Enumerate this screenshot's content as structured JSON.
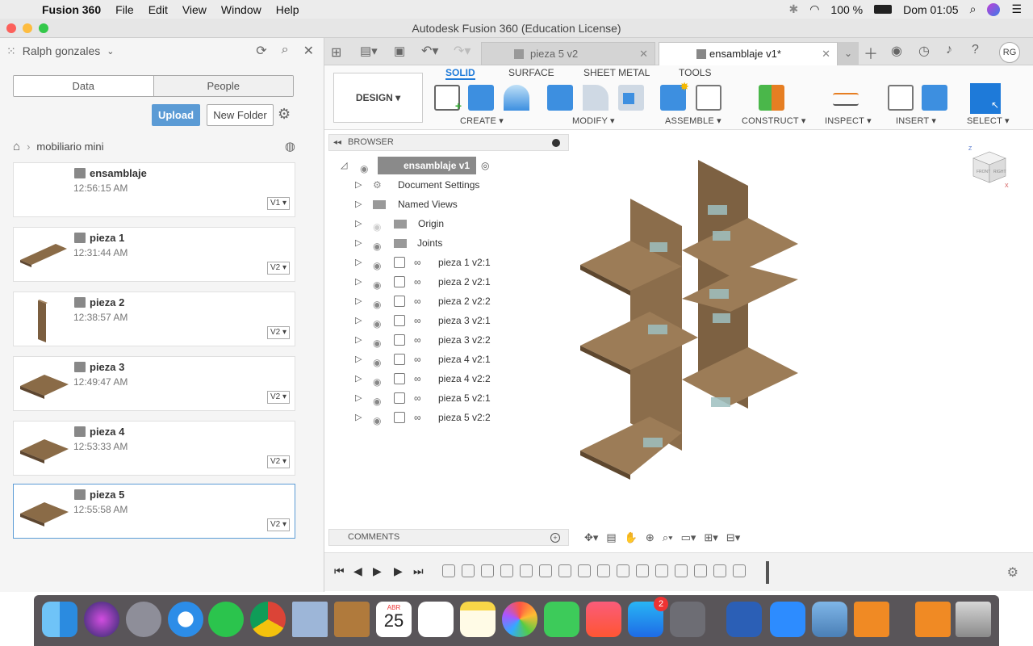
{
  "menubar": {
    "app": "Fusion 360",
    "items": [
      "File",
      "Edit",
      "View",
      "Window",
      "Help"
    ],
    "battery": "100 %",
    "clock": "Dom 01:05"
  },
  "window": {
    "title": "Autodesk Fusion 360 (Education License)"
  },
  "leftpanel": {
    "user": "Ralph gonzales",
    "tabs": {
      "data": "Data",
      "people": "People"
    },
    "upload": "Upload",
    "new_folder": "New Folder",
    "breadcrumb": "mobiliario mini",
    "files": [
      {
        "name": "ensamblaje",
        "time": "12:56:15 AM",
        "version": "V1"
      },
      {
        "name": "pieza 1",
        "time": "12:31:44 AM",
        "version": "V2"
      },
      {
        "name": "pieza 2",
        "time": "12:38:57 AM",
        "version": "V2"
      },
      {
        "name": "pieza 3",
        "time": "12:49:47 AM",
        "version": "V2"
      },
      {
        "name": "pieza 4",
        "time": "12:53:33 AM",
        "version": "V2"
      },
      {
        "name": "pieza 5",
        "time": "12:55:58 AM",
        "version": "V2"
      }
    ]
  },
  "tabs": {
    "t1": "pieza 5 v2",
    "t2": "ensamblaje v1*",
    "user": "RG"
  },
  "toolbar": {
    "design": "DESIGN",
    "tabs": [
      "SOLID",
      "SURFACE",
      "SHEET METAL",
      "TOOLS"
    ],
    "groups": [
      "CREATE",
      "MODIFY",
      "ASSEMBLE",
      "CONSTRUCT",
      "INSPECT",
      "INSERT",
      "SELECT"
    ]
  },
  "browser": {
    "title": "BROWSER",
    "root": "ensamblaje v1",
    "items": [
      "Document Settings",
      "Named Views",
      "Origin",
      "Joints",
      "pieza 1 v2:1",
      "pieza 2 v2:1",
      "pieza 2 v2:2",
      "pieza 3 v2:1",
      "pieza 3 v2:2",
      "pieza 4 v2:1",
      "pieza 4 v2:2",
      "pieza 5 v2:1",
      "pieza 5 v2:2"
    ]
  },
  "comments": "COMMENTS",
  "viewcube": {
    "face1": "FRONT",
    "face2": "RIGHT",
    "axis_z": "Z",
    "axis_x": "X"
  },
  "dock": {
    "calendar_month": "ABR",
    "calendar_day": "25",
    "appstore_badge": "2"
  }
}
